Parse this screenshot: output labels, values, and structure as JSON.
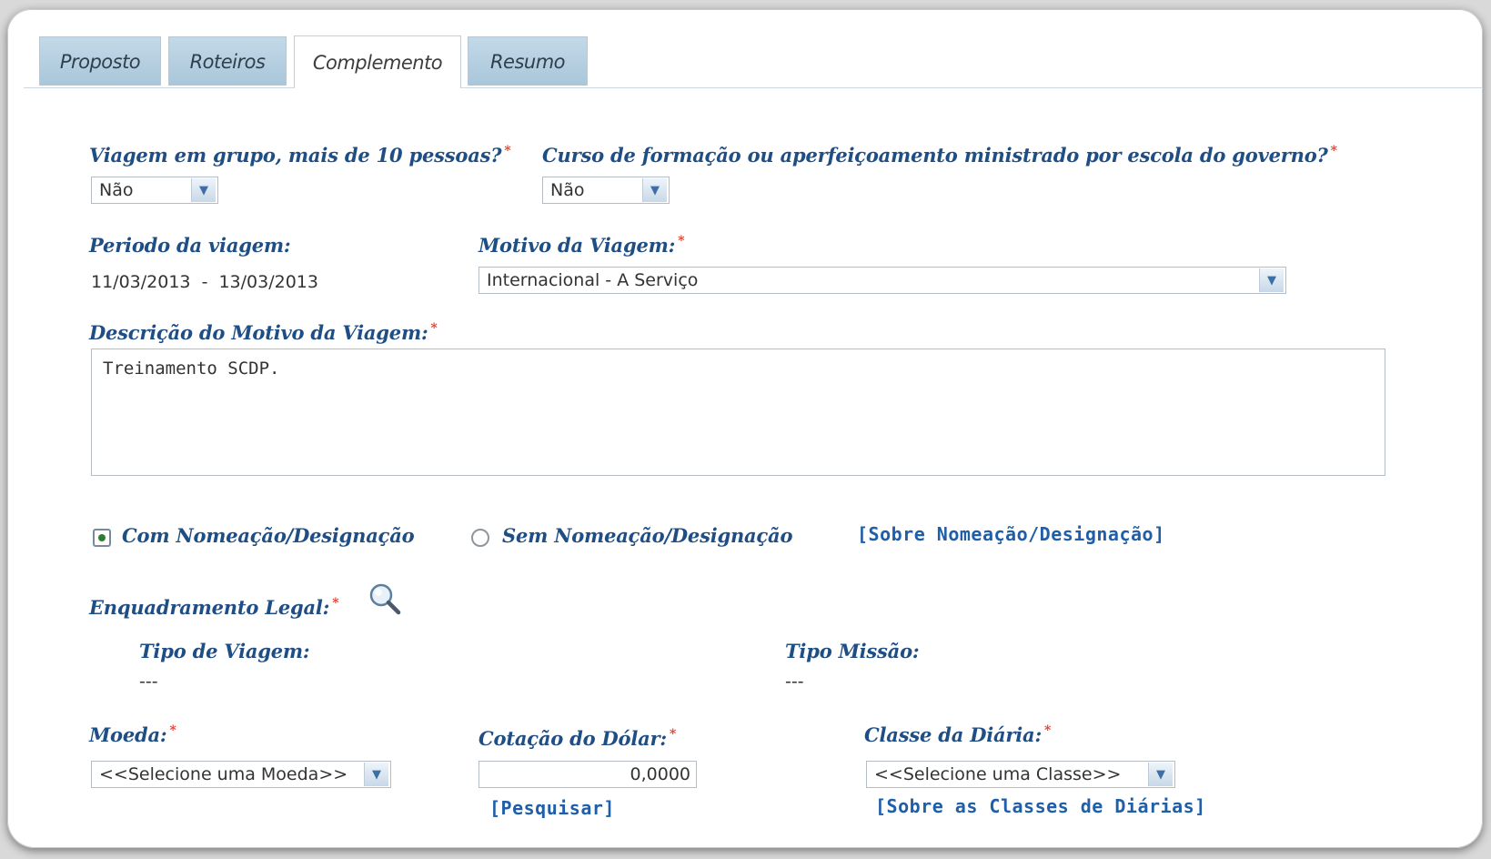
{
  "tabs": [
    {
      "label": "Proposto",
      "active": false
    },
    {
      "label": "Roteiros",
      "active": false
    },
    {
      "label": "Complemento",
      "active": true
    },
    {
      "label": "Resumo",
      "active": false
    }
  ],
  "form": {
    "group_travel": {
      "label": "Viagem em grupo, mais de 10 pessoas?",
      "value": "Não"
    },
    "course": {
      "label": "Curso de formação ou aperfeiçoamento ministrado por escola do governo?",
      "value": "Não"
    },
    "period": {
      "label": "Periodo da viagem:",
      "start": "11/03/2013",
      "separator": "-",
      "end": "13/03/2013"
    },
    "motive": {
      "label": "Motivo da Viagem:",
      "value": "Internacional - A Serviço"
    },
    "description": {
      "label": "Descrição do Motivo da Viagem:",
      "value": "Treinamento SCDP."
    },
    "nomination": {
      "with_label": "Com Nomeação/Designação",
      "without_label": "Sem Nomeação/Designação",
      "about_link": "[Sobre Nomeação/Designação]",
      "selected": "with"
    },
    "legal": {
      "label": "Enquadramento Legal:"
    },
    "trip_type": {
      "label": "Tipo de Viagem:",
      "value": "---"
    },
    "mission_type": {
      "label": "Tipo Missão:",
      "value": "---"
    },
    "currency": {
      "label": "Moeda:",
      "value": "<<Selecione uma Moeda>>"
    },
    "dollar": {
      "label": "Cotação do Dólar:",
      "value": "0,0000",
      "search_link": "[Pesquisar]"
    },
    "daily_class": {
      "label": "Classe da Diária:",
      "value": "<<Selecione uma Classe>>",
      "about_link": "[Sobre as Classes de Diárias]"
    }
  },
  "required_mark": "*",
  "colors": {
    "label": "#1f4e85",
    "required": "#e03a2c",
    "link": "#1f5ea8",
    "tab": "#b0cbe0"
  }
}
